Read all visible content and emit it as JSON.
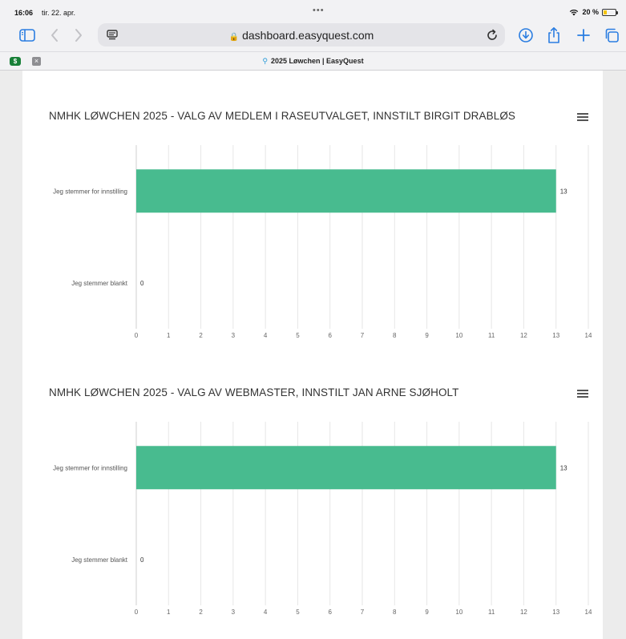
{
  "status_bar": {
    "time": "16:06",
    "date": "tir. 22. apr.",
    "dots": "•••",
    "battery": "20 %"
  },
  "toolbar": {
    "url": "dashboard.easyquest.com",
    "icons": [
      "sidebar-icon",
      "back-icon",
      "forward-icon",
      "reader-icon",
      "reload-icon",
      "download-icon",
      "share-icon",
      "new-tab-icon",
      "tabs-icon"
    ]
  },
  "tab": {
    "favicon": "$",
    "close": "×",
    "title": "2025 Løwchen | EasyQuest"
  },
  "colors": {
    "bar": "#48bb8f",
    "grid": "#e6e6e6",
    "accent": "#2a7de1"
  },
  "charts": [
    {
      "title": "NMHK LØWCHEN 2025 - VALG AV MEDLEM I RASEUTVALGET, INNSTILT BIRGIT DRABLØS"
    },
    {
      "title": "NMHK LØWCHEN 2025 - VALG AV WEBMASTER, INNSTILT JAN ARNE SJØHOLT"
    }
  ],
  "chart_data": [
    {
      "type": "bar",
      "orientation": "horizontal",
      "title": "NMHK LØWCHEN 2025 - VALG AV MEDLEM I RASEUTVALGET, INNSTILT BIRGIT DRABLØS",
      "categories": [
        "Jeg stemmer for innstilling",
        "Jeg stemmer blankt"
      ],
      "values": [
        13,
        0
      ],
      "data_labels": [
        "13",
        "0"
      ],
      "xlim": [
        0,
        14
      ],
      "xticks": [
        "0",
        "1",
        "2",
        "3",
        "4",
        "5",
        "6",
        "7",
        "8",
        "9",
        "10",
        "11",
        "12",
        "13",
        "14"
      ],
      "grid": true
    },
    {
      "type": "bar",
      "orientation": "horizontal",
      "title": "NMHK LØWCHEN 2025 - VALG AV WEBMASTER, INNSTILT JAN ARNE SJØHOLT",
      "categories": [
        "Jeg stemmer for innstilling",
        "Jeg stemmer blankt"
      ],
      "values": [
        13,
        0
      ],
      "data_labels": [
        "13",
        "0"
      ],
      "xlim": [
        0,
        14
      ],
      "xticks": [
        "0",
        "1",
        "2",
        "3",
        "4",
        "5",
        "6",
        "7",
        "8",
        "9",
        "10",
        "11",
        "12",
        "13",
        "14"
      ],
      "grid": true
    }
  ]
}
